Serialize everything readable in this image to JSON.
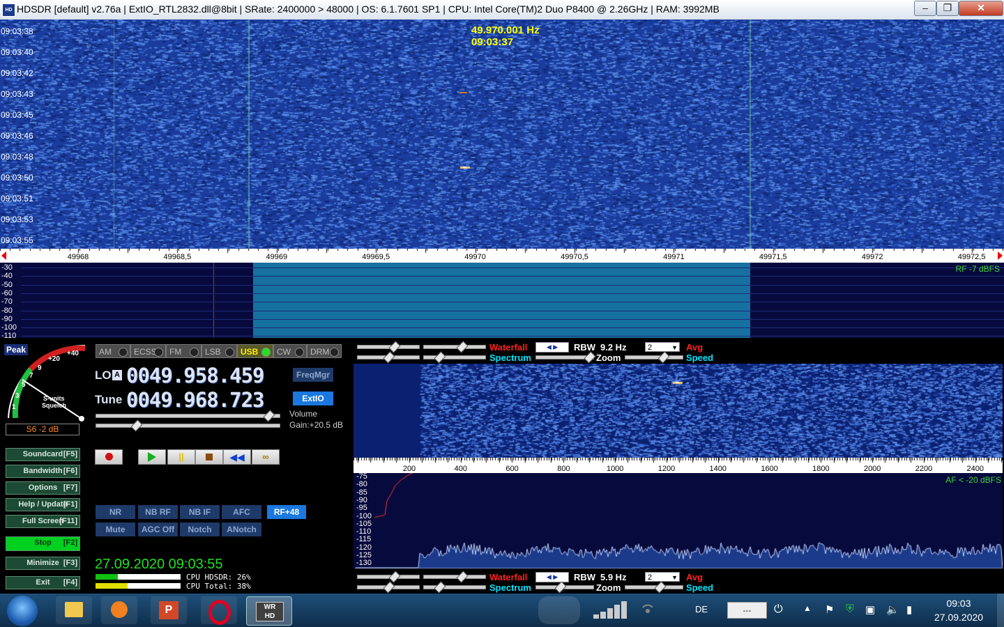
{
  "window": {
    "title": "HDSDR  [default]  v2.76a   |  ExtIO_RTL2832.dll@8bit  |  SRate: 2400000 > 48000  |  OS: 6.1.7601 SP1  |  CPU: Intel Core(TM)2 Duo      P8400  @ 2.26GHz  |  RAM: 3992MB",
    "minimize": "‒",
    "maximize": "❐",
    "close": "✕"
  },
  "waterfall": {
    "cursor_freq": "49.970.001 Hz",
    "cursor_time": "09:03:37",
    "timestamps": [
      "09:03:38",
      "09:03:40",
      "09:03:42",
      "09:03:43",
      "09:03:45",
      "09:03:46",
      "09:03:48",
      "09:03:50",
      "09:03:51",
      "09:03:53",
      "09:03:55"
    ]
  },
  "freq_scale": {
    "ticks": [
      "49968",
      "49968,5",
      "49969",
      "49969,5",
      "49970",
      "49970,5",
      "49971",
      "49971,5",
      "49972",
      "49972,5"
    ]
  },
  "spectrum": {
    "levels": [
      "-30",
      "-40",
      "-50",
      "-60",
      "-70",
      "-80",
      "-90",
      "-100",
      "-110"
    ],
    "rf_readout": "RF  -7 dBFS"
  },
  "smeter": {
    "mode": "Peak",
    "scale": [
      "+40",
      "+20",
      "9",
      "7",
      "5",
      "3",
      "1"
    ],
    "label1": "S-units",
    "label2": "Squelch",
    "reading": "S6 -2 dB"
  },
  "modes": [
    "AM",
    "ECSS",
    "FM",
    "LSB",
    "USB",
    "CW",
    "DRM"
  ],
  "active_mode": "USB",
  "lo": {
    "label": "LO",
    "a": "A",
    "value": "0049.958.459"
  },
  "tune": {
    "label": "Tune",
    "value": "0049.968.723"
  },
  "buttons": {
    "freqmgr": "FreqMgr",
    "extio": "ExtIO",
    "volume": "Volume",
    "gain": "Gain:+20.5 dB"
  },
  "side_buttons": [
    {
      "label": "Soundcard",
      "key": "[F5]"
    },
    {
      "label": "Bandwidth",
      "key": "[F6]"
    },
    {
      "label": "Options",
      "key": "[F7]"
    },
    {
      "label": "Help / Update",
      "key": "[F1]"
    },
    {
      "label": "Full Screen",
      "key": "[F11]"
    },
    {
      "label": "Stop",
      "key": "[F2]"
    },
    {
      "label": "Minimize",
      "key": "[F3]"
    },
    {
      "label": "Exit",
      "key": "[F4]"
    }
  ],
  "dsp": {
    "row1": [
      "NR",
      "NB RF",
      "NB IF",
      "AFC",
      "RF+48"
    ],
    "row2": [
      "Mute",
      "AGC Off",
      "Notch",
      "ANotch"
    ]
  },
  "datetime": "27.09.2020 09:03:55",
  "cpu": {
    "hdsdr": "CPU HDSDR: 26%",
    "total": "CPU Total: 38%",
    "hdsdr_pct": 26,
    "total_pct": 38
  },
  "rf_controls": {
    "waterfall": "Waterfall",
    "spectrum": "Spectrum",
    "rbw": "RBW",
    "rbw_val": "9.2 Hz",
    "zoom": "Zoom",
    "avg": "Avg",
    "speed": "Speed",
    "select": "2"
  },
  "af_controls": {
    "waterfall": "Waterfall",
    "spectrum": "Spectrum",
    "rbw": "RBW",
    "rbw_val": "5.9 Hz",
    "zoom": "Zoom",
    "avg": "Avg",
    "speed": "Speed",
    "select": "2"
  },
  "af_scale": {
    "ticks": [
      "200",
      "400",
      "600",
      "800",
      "1000",
      "1200",
      "1400",
      "1600",
      "1800",
      "2000",
      "2200",
      "2400"
    ]
  },
  "af_spectrum": {
    "levels": [
      "-75",
      "-80",
      "-85",
      "-90",
      "-95",
      "-100",
      "-105",
      "-110",
      "-115",
      "-120",
      "-125",
      "-130"
    ],
    "af_readout": "AF < -20 dBFS"
  },
  "taskbar": {
    "lang": "DE",
    "clock_time": "09:03",
    "clock_date": "27.09.2020",
    "tray_box": "---",
    "apps": [
      "start-orb",
      "explorer",
      "media-player",
      "powerpoint",
      "opera",
      "hdsdr"
    ]
  },
  "colors": {
    "accent_red": "#ff2020",
    "spectrum_cyan": "#00e5ff",
    "readout_yellow": "#ffff00",
    "readout_green": "#3cd63c",
    "stop_green": "#00d020"
  }
}
